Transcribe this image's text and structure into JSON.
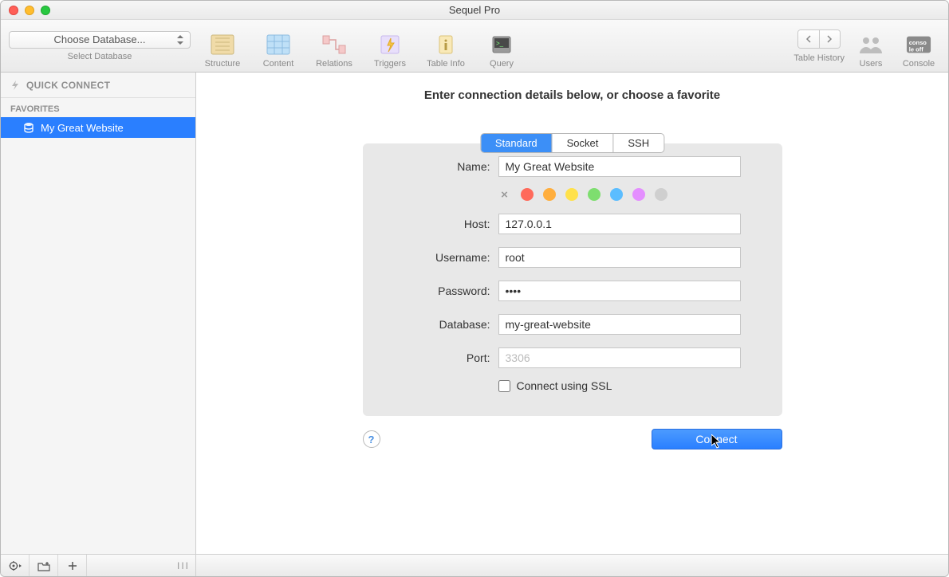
{
  "window": {
    "title": "Sequel Pro"
  },
  "toolbar": {
    "db_select": "Choose Database...",
    "db_select_label": "Select Database",
    "buttons": {
      "structure": "Structure",
      "content": "Content",
      "relations": "Relations",
      "triggers": "Triggers",
      "tableinfo": "Table Info",
      "query": "Query"
    },
    "right": {
      "tablehistory": "Table History",
      "users": "Users",
      "console": "Console"
    }
  },
  "sidebar": {
    "quickconnect": "QUICK CONNECT",
    "favorites_header": "FAVORITES",
    "favorites": [
      {
        "label": "My Great Website"
      }
    ]
  },
  "main": {
    "instruction": "Enter connection details below, or choose a favorite",
    "tabs": {
      "standard": "Standard",
      "socket": "Socket",
      "ssh": "SSH"
    },
    "labels": {
      "name": "Name:",
      "host": "Host:",
      "username": "Username:",
      "password": "Password:",
      "database": "Database:",
      "port": "Port:"
    },
    "values": {
      "name": "My Great Website",
      "host": "127.0.0.1",
      "username": "root",
      "password": "••••",
      "database": "my-great-website",
      "port_placeholder": "3306"
    },
    "ssl_label": "Connect using SSL",
    "connect_label": "Connect",
    "help_label": "?",
    "color_tags": [
      "#ff6a5b",
      "#ffae3d",
      "#ffe14a",
      "#7ede6f",
      "#5bbdff",
      "#e48fff",
      "#cfcfcf"
    ]
  }
}
